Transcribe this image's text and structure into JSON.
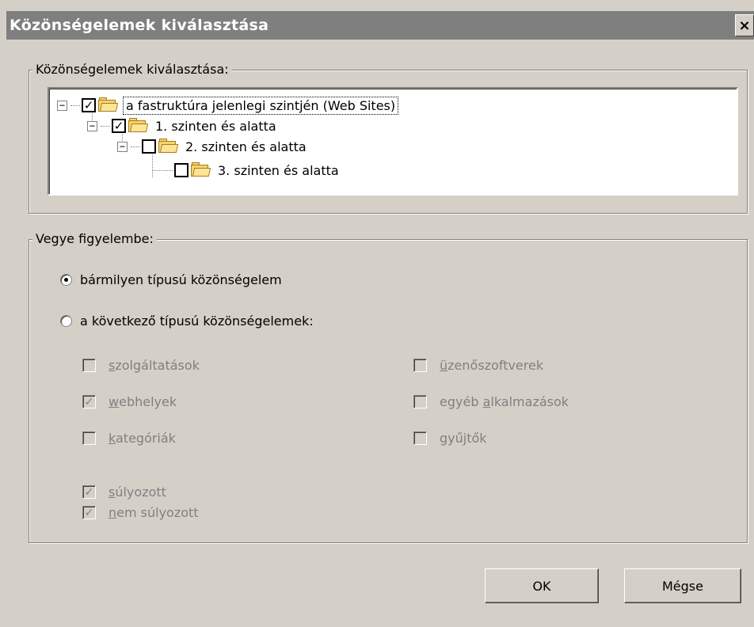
{
  "window": {
    "title": "Közönségelemek kiválasztása",
    "close_label": "×"
  },
  "tree_group": {
    "legend": "Közönségelemek kiválasztása:",
    "items": [
      {
        "label": "a fastruktúra jelenlegi szintjén (Web Sites)",
        "checked": true,
        "expander": "−",
        "selected": true
      },
      {
        "label": "1. szinten és alatta",
        "checked": true,
        "expander": "−",
        "selected": false
      },
      {
        "label": "2. szinten és alatta",
        "checked": false,
        "expander": "−",
        "selected": false
      },
      {
        "label": "3. szinten és alatta",
        "checked": false,
        "expander": "",
        "selected": false
      }
    ]
  },
  "consider_group": {
    "legend": "Vegye figyelembe:",
    "radios": [
      {
        "label": "bármilyen típusú közönségelem",
        "selected": true
      },
      {
        "label": "a következő típusú közönségelemek:",
        "selected": false
      }
    ],
    "type_checkboxes_left": [
      {
        "label": "szolgáltatások",
        "checked": false,
        "accel": "s",
        "rest": "zolgáltatások"
      },
      {
        "label": "webhelyek",
        "checked": true,
        "accel": "w",
        "rest": "ebhelyek"
      },
      {
        "label": "kategóriák",
        "checked": false,
        "accel": "k",
        "rest": "ategóriák"
      }
    ],
    "type_checkboxes_right": [
      {
        "label": "üzenőszoftverek",
        "checked": false,
        "accel": "ü",
        "rest": "zenőszoftverek"
      },
      {
        "label": "egyéb alkalmazások",
        "checked": false,
        "pre": "egyéb ",
        "accel": "a",
        "rest": "lkalmazások"
      },
      {
        "label": "gyűjtők",
        "checked": false,
        "accel": "g",
        "rest": "yűjtők"
      }
    ],
    "weight_checkboxes": [
      {
        "label": "súlyozott",
        "checked": true,
        "accel": "s",
        "rest": "úlyozott"
      },
      {
        "label": "nem súlyozott",
        "checked": true,
        "accel": "n",
        "rest": "em súlyozott"
      }
    ]
  },
  "buttons": {
    "ok": "OK",
    "cancel": "Mégse"
  },
  "icons": {
    "folder": "folder-icon",
    "check": "✓",
    "close": "close-icon"
  }
}
